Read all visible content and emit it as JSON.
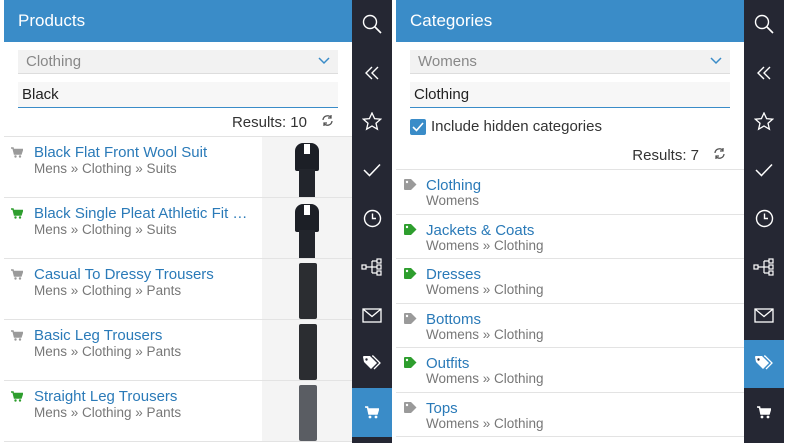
{
  "products_panel": {
    "title": "Products",
    "category_select": "Clothing",
    "search_value": "Black",
    "results_label": "Results: 10",
    "items": [
      {
        "title": "Black Flat Front Wool Suit",
        "path": "Mens » Clothing » Suits",
        "cart_color": "gray",
        "thumb": "suit"
      },
      {
        "title": "Black Single Pleat Athletic Fit …",
        "path": "Mens » Clothing » Suits",
        "cart_color": "green",
        "thumb": "suit"
      },
      {
        "title": "Casual To Dressy Trousers",
        "path": "Mens » Clothing » Pants",
        "cart_color": "gray",
        "thumb": "trouser"
      },
      {
        "title": "Basic Leg Trousers",
        "path": "Mens » Clothing » Pants",
        "cart_color": "gray",
        "thumb": "trouser-black"
      },
      {
        "title": "Straight Leg Trousers",
        "path": "Mens » Clothing » Pants",
        "cart_color": "green",
        "thumb": "trouser-gray"
      }
    ]
  },
  "categories_panel": {
    "title": "Categories",
    "category_select": "Womens",
    "search_value": "Clothing",
    "include_hidden_label": "Include hidden categories",
    "results_label": "Results: 7",
    "items": [
      {
        "title": "Clothing",
        "path": "Womens",
        "tag_color": "#9a9a9a"
      },
      {
        "title": "Jackets & Coats",
        "path": "Womens » Clothing",
        "tag_color": "#2e9e2e"
      },
      {
        "title": "Dresses",
        "path": "Womens » Clothing",
        "tag_color": "#2e9e2e"
      },
      {
        "title": "Bottoms",
        "path": "Womens » Clothing",
        "tag_color": "#9a9a9a"
      },
      {
        "title": "Outfits",
        "path": "Womens » Clothing",
        "tag_color": "#2e9e2e"
      },
      {
        "title": "Tops",
        "path": "Womens » Clothing",
        "tag_color": "#9a9a9a"
      }
    ]
  },
  "sidebar_icons": [
    "search-icon",
    "collapse-icon",
    "star-icon",
    "check-icon",
    "clock-icon",
    "tree-icon",
    "mail-icon",
    "tags-icon",
    "cart-icon"
  ],
  "colors": {
    "accent": "#3a8cc8",
    "sidebar": "#252733",
    "green": "#2e9e2e"
  }
}
